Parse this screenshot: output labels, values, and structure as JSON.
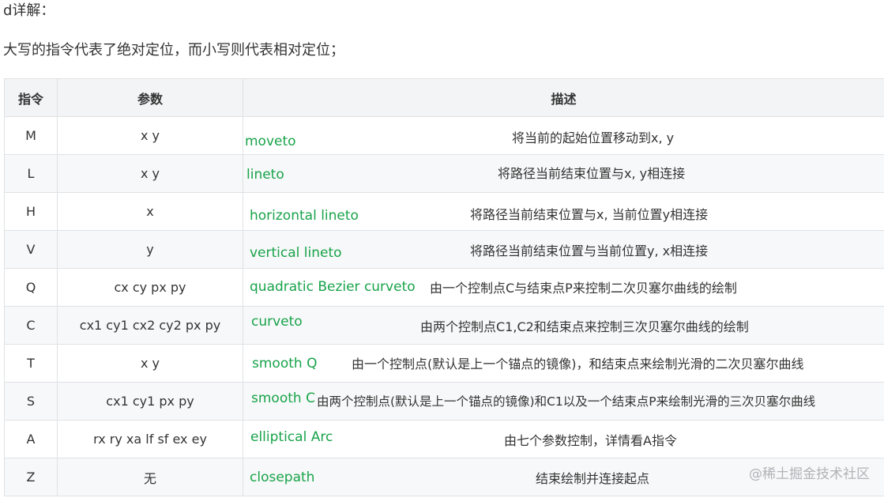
{
  "heading": "d详解：",
  "intro": "大写的指令代表了绝对定位，而小写则代表相对定位；",
  "table": {
    "headers": [
      "指令",
      "参数",
      "描述"
    ],
    "rows": [
      {
        "cmd": "M",
        "param": "x y",
        "name": "moveto",
        "desc": "将当前的起始位置移动到x, y"
      },
      {
        "cmd": "L",
        "param": "x y",
        "name": "lineto",
        "desc": "将路径当前结束位置与x, y相连接"
      },
      {
        "cmd": "H",
        "param": "x",
        "name": "horizontal lineto",
        "desc": "将路径当前结束位置与x, 当前位置y相连接"
      },
      {
        "cmd": "V",
        "param": "y",
        "name": "vertical lineto",
        "desc": "将路径当前结束位置与当前位置y, x相连接"
      },
      {
        "cmd": "Q",
        "param": "cx cy px py",
        "name": "quadratic Bezier curveto",
        "desc": "由一个控制点C与结束点P来控制二次贝塞尔曲线的绘制"
      },
      {
        "cmd": "C",
        "param": "cx1 cy1 cx2 cy2 px py",
        "name": "curveto",
        "desc": "由两个控制点C1,C2和结束点来控制三次贝塞尔曲线的绘制"
      },
      {
        "cmd": "T",
        "param": "x y",
        "name": "smooth Q",
        "desc": "由一个控制点(默认是上一个锚点的镜像)，和结束点来绘制光滑的二次贝塞尔曲线"
      },
      {
        "cmd": "S",
        "param": "cx1 cy1 px py",
        "name": "smooth C",
        "desc": "由两个控制点(默认是上一个锚点的镜像)和C1以及一个结束点P来绘制光滑的三次贝塞尔曲线"
      },
      {
        "cmd": "A",
        "param": "rx ry xa lf sf ex ey",
        "name": "elliptical Arc",
        "desc": "由七个参数控制，详情看A指令"
      },
      {
        "cmd": "Z",
        "param": "无",
        "name": "closepath",
        "desc": "结束绘制并连接起点"
      }
    ]
  },
  "watermark": "@稀土掘金技术社区"
}
